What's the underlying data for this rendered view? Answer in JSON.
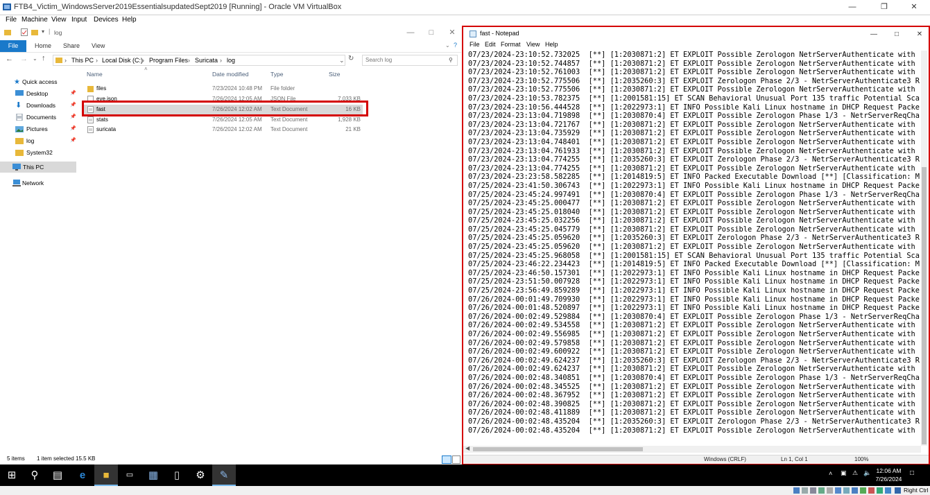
{
  "vbox": {
    "title": "FTB4_Victim_WindowsServer2019EssentialsupdatedSept2019 [Running] - Oracle VM VirtualBox",
    "menu": [
      "File",
      "Machine",
      "View",
      "Input",
      "Devices",
      "Help"
    ],
    "host_key": "Right Ctrl"
  },
  "explorer": {
    "title": "log",
    "ribbon": {
      "file": "File",
      "tabs": [
        "Home",
        "Share",
        "View"
      ]
    },
    "address": {
      "path": [
        "This PC",
        "Local Disk (C:)",
        "Program Files",
        "Suricata",
        "log"
      ]
    },
    "search": {
      "placeholder": "Search log"
    },
    "nav": {
      "quick_access": "Quick access",
      "items": [
        "Desktop",
        "Downloads",
        "Documents",
        "Pictures",
        "log",
        "System32"
      ],
      "this_pc": "This PC",
      "network": "Network"
    },
    "columns": {
      "name": "Name",
      "date": "Date modified",
      "type": "Type",
      "size": "Size"
    },
    "files": [
      {
        "name": "files",
        "date": "7/23/2024 10:48 PM",
        "type": "File folder",
        "size": ""
      },
      {
        "name": "eve.json",
        "date": "7/26/2024 12:05 AM",
        "type": "JSON File",
        "size": "7,033 KB"
      },
      {
        "name": "fast",
        "date": "7/26/2024 12:02 AM",
        "type": "Text Document",
        "size": "16 KB"
      },
      {
        "name": "stats",
        "date": "7/26/2024 12:05 AM",
        "type": "Text Document",
        "size": "1,928 KB"
      },
      {
        "name": "suricata",
        "date": "7/26/2024 12:02 AM",
        "type": "Text Document",
        "size": "21 KB"
      }
    ],
    "status": {
      "items": "5 items",
      "selected": "1 item selected  15.5 KB"
    }
  },
  "notepad": {
    "title": "fast - Notepad",
    "menu": [
      "File",
      "Edit",
      "Format",
      "View",
      "Help"
    ],
    "lines": [
      "07/23/2024-23:10:52.732025  [**] [1:2030871:2] ET EXPLOIT Possible Zerologon NetrServerAuthenticate with 0x00 Client",
      "07/23/2024-23:10:52.744857  [**] [1:2030871:2] ET EXPLOIT Possible Zerologon NetrServerAuthenticate with 0x00 Client",
      "07/23/2024-23:10:52.761003  [**] [1:2030871:2] ET EXPLOIT Possible Zerologon NetrServerAuthenticate with 0x00 Client",
      "07/23/2024-23:10:52.775506  [**] [1:2035260:3] ET EXPLOIT Zerologon Phase 2/3 - NetrServerAuthenticate3 Request with",
      "07/23/2024-23:10:52.775506  [**] [1:2030871:2] ET EXPLOIT Possible Zerologon NetrServerAuthenticate with 0x00 Client",
      "07/23/2024-23:10:53.782375  [**] [1:2001581:15] ET SCAN Behavioral Unusual Port 135 traffic Potential Scan or Infecti",
      "07/23/2024-23:10:56.444528  [**] [1:2022973:1] ET INFO Possible Kali Linux hostname in DHCP Request Packet [**] [Clas",
      "07/23/2024-23:13:04.719898  [**] [1:2030870:4] ET EXPLOIT Possible Zerologon Phase 1/3 - NetrServerReqChallenge with",
      "07/23/2024-23:13:04.721767  [**] [1:2030871:2] ET EXPLOIT Possible Zerologon NetrServerAuthenticate with 0x00 Client",
      "07/23/2024-23:13:04.735929  [**] [1:2030871:2] ET EXPLOIT Possible Zerologon NetrServerAuthenticate with 0x00 Client",
      "07/23/2024-23:13:04.748401  [**] [1:2030871:2] ET EXPLOIT Possible Zerologon NetrServerAuthenticate with 0x00 Client",
      "07/23/2024-23:13:04.761933  [**] [1:2030871:2] ET EXPLOIT Possible Zerologon NetrServerAuthenticate with 0x00 Client",
      "07/23/2024-23:13:04.774255  [**] [1:2035260:3] ET EXPLOIT Zerologon Phase 2/3 - NetrServerAuthenticate3 Request with",
      "07/23/2024-23:13:04.774255  [**] [1:2030871:2] ET EXPLOIT Possible Zerologon NetrServerAuthenticate with 0x00 Client",
      "07/23/2024-23:23:58.582285  [**] [1:2014819:5] ET INFO Packed Executable Download [**] [Classification: Misc activity",
      "07/25/2024-23:41:50.306743  [**] [1:2022973:1] ET INFO Possible Kali Linux hostname in DHCP Request Packet [**] [Clas",
      "07/25/2024-23:45:24.997491  [**] [1:2030870:4] ET EXPLOIT Possible Zerologon Phase 1/3 - NetrServerReqChallenge with",
      "07/25/2024-23:45:25.000477  [**] [1:2030871:2] ET EXPLOIT Possible Zerologon NetrServerAuthenticate with 0x00 Client",
      "07/25/2024-23:45:25.018040  [**] [1:2030871:2] ET EXPLOIT Possible Zerologon NetrServerAuthenticate with 0x00 Client",
      "07/25/2024-23:45:25.032256  [**] [1:2030871:2] ET EXPLOIT Possible Zerologon NetrServerAuthenticate with 0x00 Client",
      "07/25/2024-23:45:25.045779  [**] [1:2030871:2] ET EXPLOIT Possible Zerologon NetrServerAuthenticate with 0x00 Client",
      "07/25/2024-23:45:25.059620  [**] [1:2035260:3] ET EXPLOIT Zerologon Phase 2/3 - NetrServerAuthenticate3 Request with",
      "07/25/2024-23:45:25.059620  [**] [1:2030871:2] ET EXPLOIT Possible Zerologon NetrServerAuthenticate with 0x00 Client",
      "07/25/2024-23:45:25.968058  [**] [1:2001581:15] ET SCAN Behavioral Unusual Port 135 traffic Potential Scan or Infecti",
      "07/25/2024-23:46:22.234423  [**] [1:2014819:5] ET INFO Packed Executable Download [**] [Classification: Misc activity",
      "07/25/2024-23:46:50.157301  [**] [1:2022973:1] ET INFO Possible Kali Linux hostname in DHCP Request Packet [**] [Clas",
      "07/25/2024-23:51:50.007928  [**] [1:2022973:1] ET INFO Possible Kali Linux hostname in DHCP Request Packet [**] [Clas",
      "07/25/2024-23:56:49.859289  [**] [1:2022973:1] ET INFO Possible Kali Linux hostname in DHCP Request Packet [**] [Clas",
      "07/26/2024-00:01:49.709930  [**] [1:2022973:1] ET INFO Possible Kali Linux hostname in DHCP Request Packet [**] [Clas",
      "07/26/2024-00:01:48.520897  [**] [1:2022973:1] ET INFO Possible Kali Linux hostname in DHCP Request Packet [**] [Clas",
      "07/26/2024-00:02:49.529884  [**] [1:2030870:4] ET EXPLOIT Possible Zerologon Phase 1/3 - NetrServerReqChallenge with",
      "07/26/2024-00:02:49.534558  [**] [1:2030871:2] ET EXPLOIT Possible Zerologon NetrServerAuthenticate with 0x00 Client",
      "07/26/2024-00:02:49.556985  [**] [1:2030871:2] ET EXPLOIT Possible Zerologon NetrServerAuthenticate with 0x00 Client",
      "07/26/2024-00:02:49.579858  [**] [1:2030871:2] ET EXPLOIT Possible Zerologon NetrServerAuthenticate with 0x00 Client",
      "07/26/2024-00:02:49.600922  [**] [1:2030871:2] ET EXPLOIT Possible Zerologon NetrServerAuthenticate with 0x00 Client",
      "07/26/2024-00:02:49.624237  [**] [1:2035260:3] ET EXPLOIT Zerologon Phase 2/3 - NetrServerAuthenticate3 Request with",
      "07/26/2024-00:02:49.624237  [**] [1:2030871:2] ET EXPLOIT Possible Zerologon NetrServerAuthenticate with 0x00 Client",
      "07/26/2024-00:02:48.340851  [**] [1:2030870:4] ET EXPLOIT Possible Zerologon Phase 1/3 - NetrServerReqChallenge with",
      "07/26/2024-00:02:48.345525  [**] [1:2030871:2] ET EXPLOIT Possible Zerologon NetrServerAuthenticate with 0x00 Client",
      "07/26/2024-00:02:48.367952  [**] [1:2030871:2] ET EXPLOIT Possible Zerologon NetrServerAuthenticate with 0x00 Client",
      "07/26/2024-00:02:48.390825  [**] [1:2030871:2] ET EXPLOIT Possible Zerologon NetrServerAuthenticate with 0x00 Client",
      "07/26/2024-00:02:48.411889  [**] [1:2030871:2] ET EXPLOIT Possible Zerologon NetrServerAuthenticate with 0x00 Client",
      "07/26/2024-00:02:48.435204  [**] [1:2035260:3] ET EXPLOIT Zerologon Phase 2/3 - NetrServerAuthenticate3 Request with",
      "07/26/2024-00:02:48.435204  [**] [1:2030871:2] ET EXPLOIT Possible Zerologon NetrServerAuthenticate with 0x00 Client"
    ],
    "status": {
      "eol": "Windows (CRLF)",
      "position": "Ln 1, Col 1",
      "zoom": "100%"
    }
  },
  "taskbar": {
    "time": "12:06 AM",
    "date": "7/26/2024"
  },
  "colors": {
    "accent": "#1979ca",
    "highlight": "#d40000",
    "selection": "#cce8ff",
    "taskbar": "#000000"
  }
}
